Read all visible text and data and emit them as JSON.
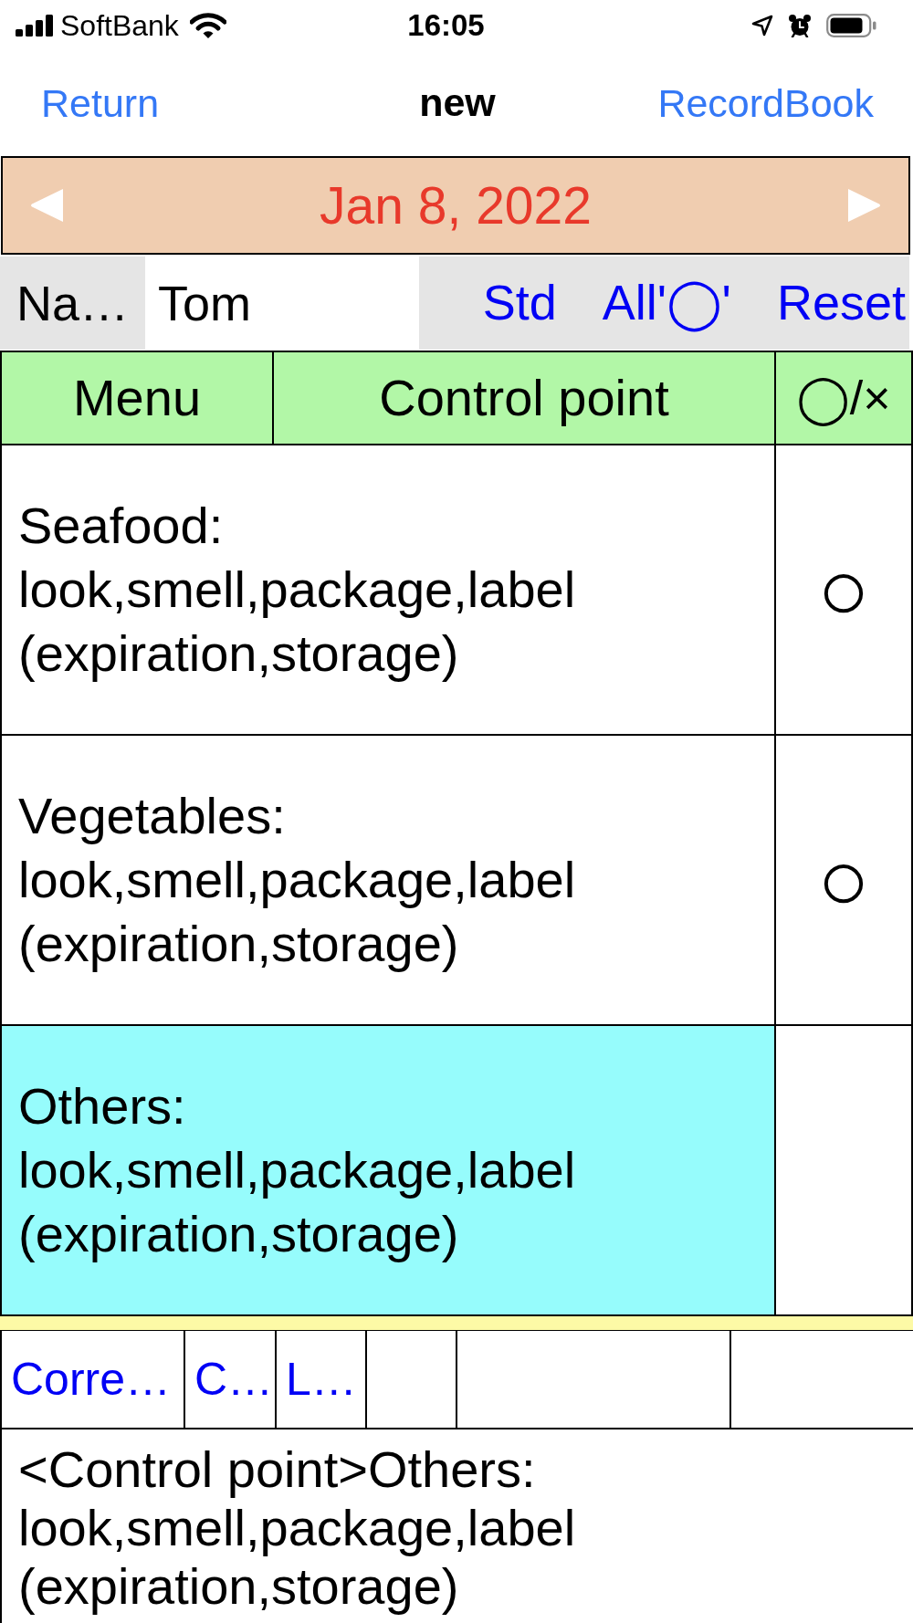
{
  "status_bar": {
    "carrier": "SoftBank",
    "time": "16:05"
  },
  "nav_bar": {
    "back": "Return",
    "title": "new",
    "action": "RecordBook"
  },
  "date_bar": {
    "date": "Jan 8, 2022"
  },
  "name_row": {
    "label": "Na…",
    "value": "Tom",
    "buttons": [
      "Std",
      "All'◯'",
      "Reset"
    ]
  },
  "table": {
    "columns": [
      "Menu",
      "Control point",
      "◯/×"
    ],
    "rows": [
      {
        "text": "Seafood:\nlook,smell,package,label\n(expiration,storage)",
        "mark": "○",
        "selected": false
      },
      {
        "text": "Vegetables:\nlook,smell,package,label\n(expiration,storage)",
        "mark": "○",
        "selected": false
      },
      {
        "text": "Others:\nlook,smell,package,label\n(expiration,storage)",
        "selected": true
      }
    ]
  },
  "toolbar": {
    "buttons": [
      "Corre…",
      "C…",
      "L…"
    ]
  },
  "detail": {
    "text": "<Control point>Others:\nlook,smell,package,label\n(expiration,storage)"
  }
}
